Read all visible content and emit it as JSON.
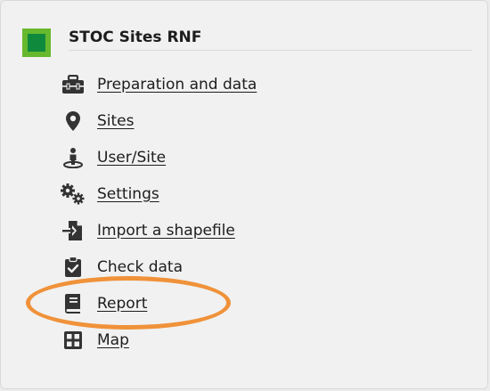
{
  "app": {
    "title": "STOC Sites RNF",
    "logo_colors": {
      "outer": "#66b82d",
      "inner": "#0f8a3d"
    }
  },
  "menu": {
    "items": [
      {
        "label": "Preparation and data",
        "icon": "toolbox-icon",
        "link": true
      },
      {
        "label": "Sites",
        "icon": "map-marker-icon",
        "link": true
      },
      {
        "label": "User/Site",
        "icon": "user-location-icon",
        "link": true
      },
      {
        "label": "Settings",
        "icon": "gears-icon",
        "link": true
      },
      {
        "label": "Import a shapefile",
        "icon": "file-import-icon",
        "link": true
      },
      {
        "label": "Check data",
        "icon": "clipboard-check-icon",
        "link": false
      },
      {
        "label": "Report",
        "icon": "book-icon",
        "link": true
      },
      {
        "label": "Map",
        "icon": "grid-map-icon",
        "link": true
      }
    ]
  },
  "annotation": {
    "highlight_color": "#f0923a",
    "highlighted_item": "Report"
  }
}
